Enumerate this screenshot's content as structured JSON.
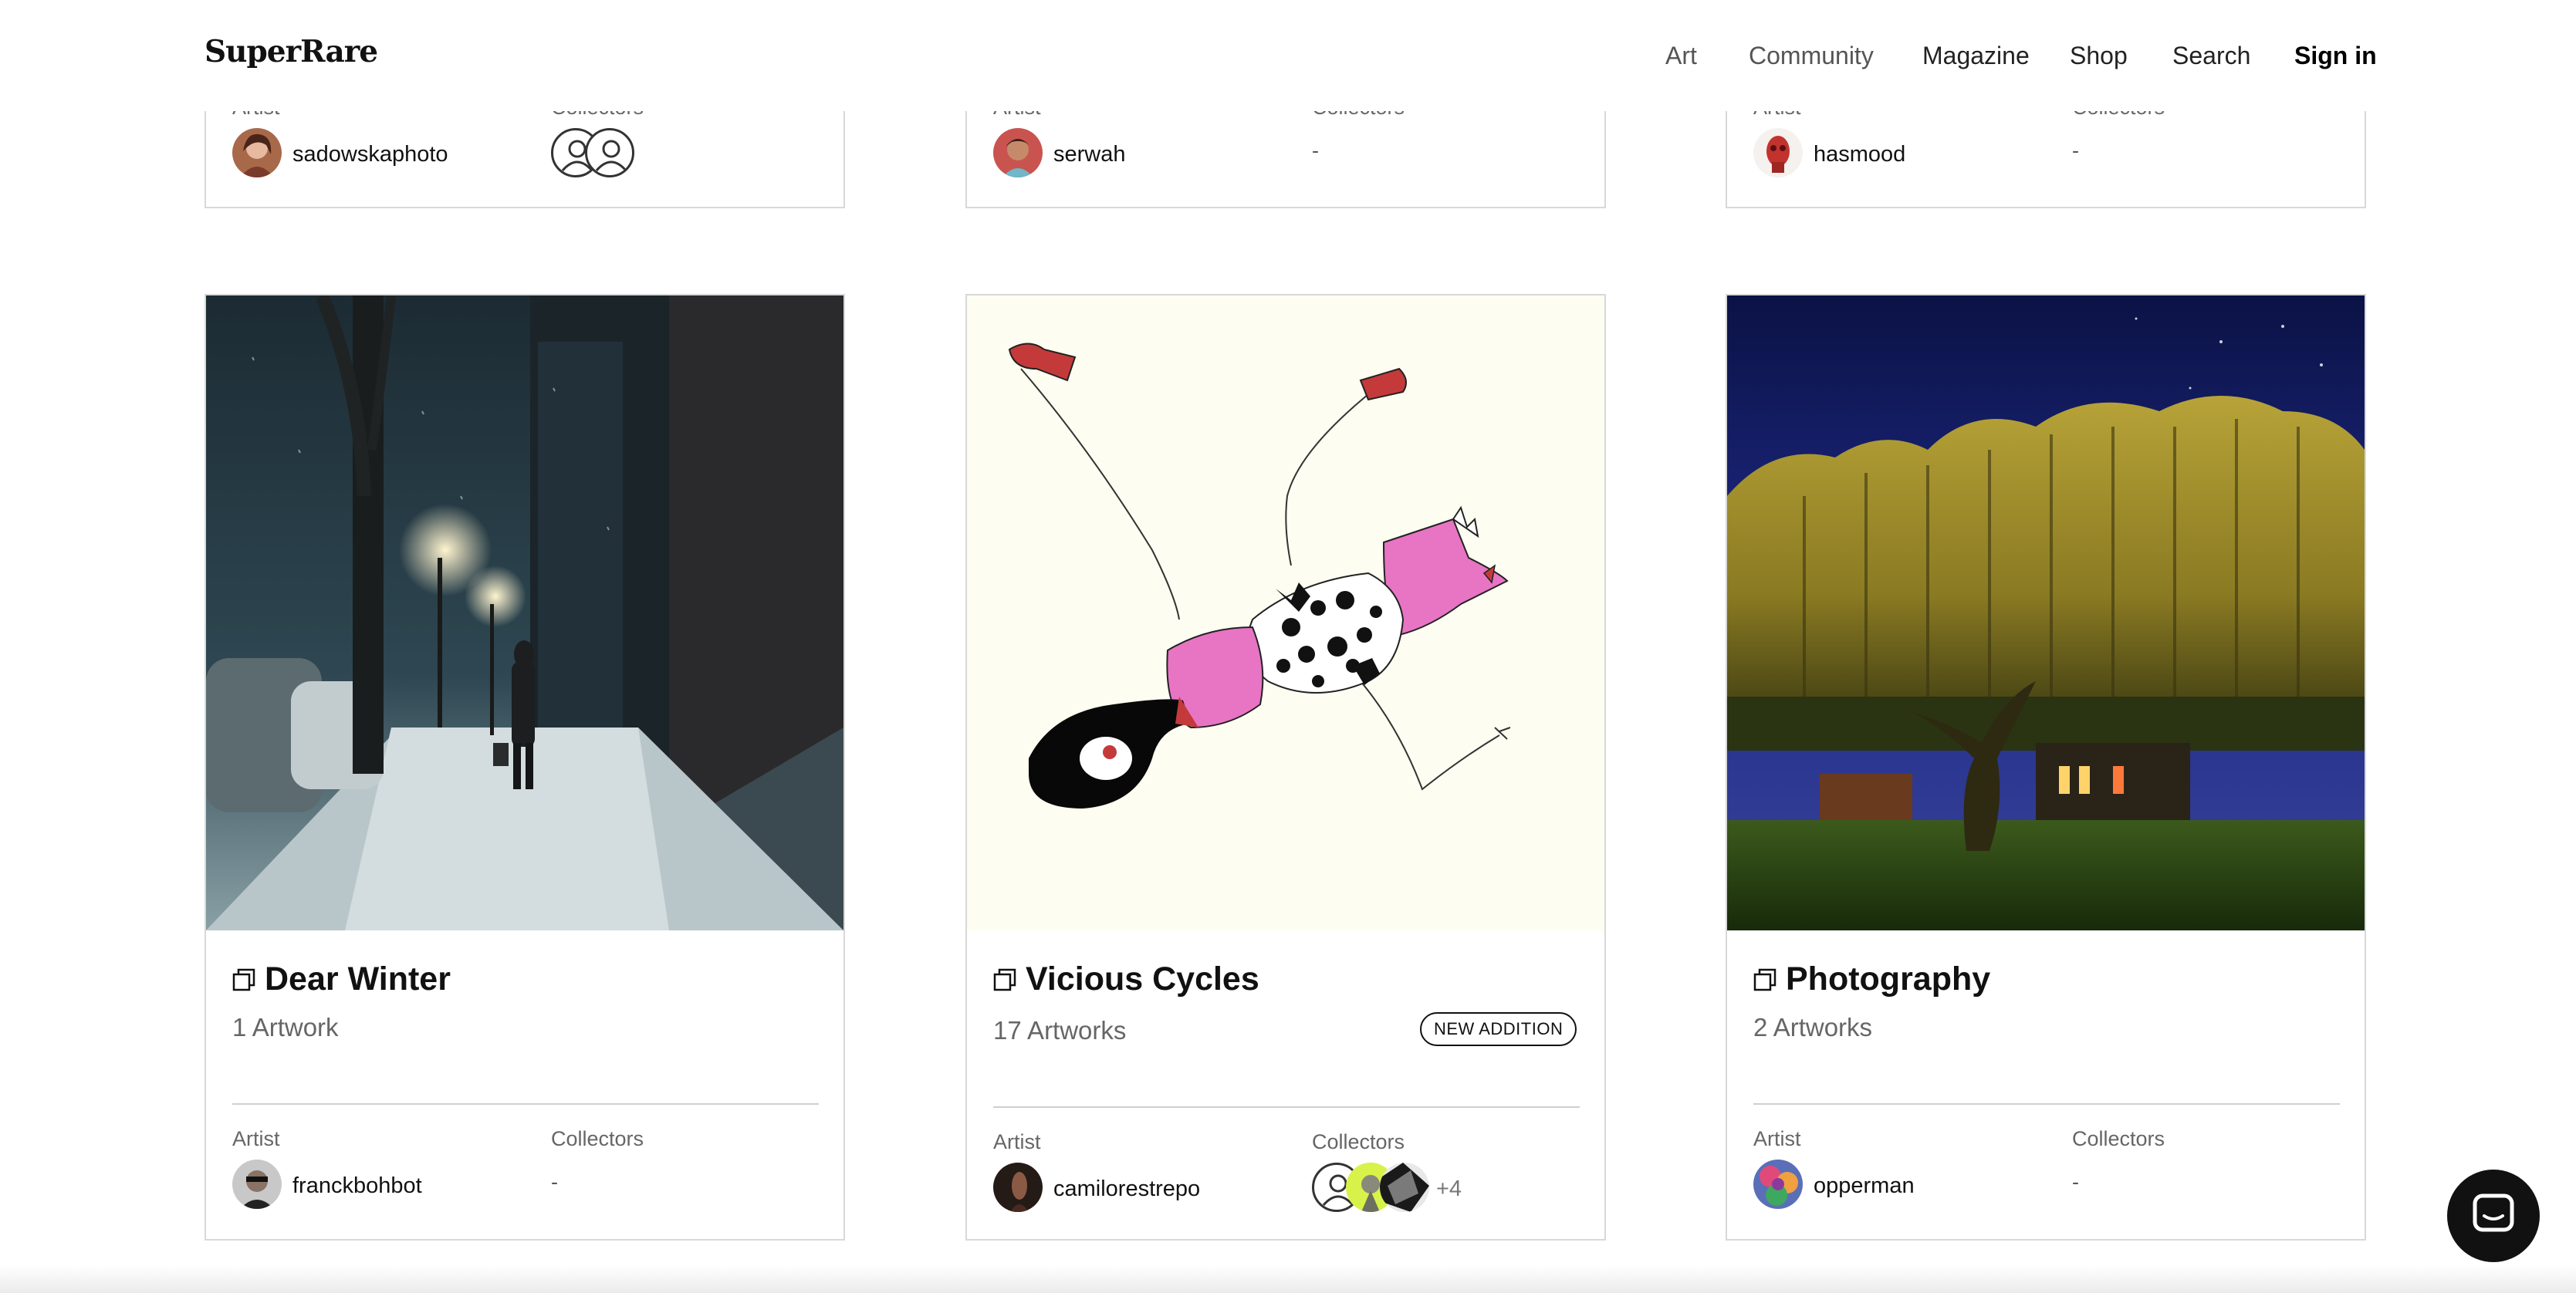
{
  "header": {
    "logo": "SuperRare",
    "nav": [
      "Art",
      "Community",
      "Magazine",
      "Shop",
      "Search"
    ],
    "sign_in": "Sign in"
  },
  "top_row": [
    {
      "artist_label": "Artist",
      "collectors_label": "Collectors",
      "artist": "sadowskaphoto",
      "collectors": ""
    },
    {
      "artist_label": "Artist",
      "collectors_label": "Collectors",
      "artist": "serwah",
      "collectors": "-"
    },
    {
      "artist_label": "Artist",
      "collectors_label": "Collectors",
      "artist": "hasmood",
      "collectors": "-"
    }
  ],
  "cards": [
    {
      "title": "Dear Winter",
      "count": "1 Artwork",
      "badge": "",
      "artist_label": "Artist",
      "collectors_label": "Collectors",
      "artist": "franckbohbot",
      "collectors": "-"
    },
    {
      "title": "Vicious Cycles",
      "count": "17 Artworks",
      "badge": "NEW ADDITION",
      "artist_label": "Artist",
      "collectors_label": "Collectors",
      "artist": "camilorestrepo",
      "collectors_more": "+4"
    },
    {
      "title": "Photography",
      "count": "2 Artworks",
      "badge": "",
      "artist_label": "Artist",
      "collectors_label": "Collectors",
      "artist": "opperman",
      "collectors": "-"
    }
  ],
  "icons": {
    "collection": "stack-icon",
    "chat": "chat-icon",
    "default_collector": "user-icon"
  },
  "colors": {
    "text": "#111111",
    "muted": "#666666",
    "border": "#d8d8d8",
    "chat_button": "#111111"
  }
}
